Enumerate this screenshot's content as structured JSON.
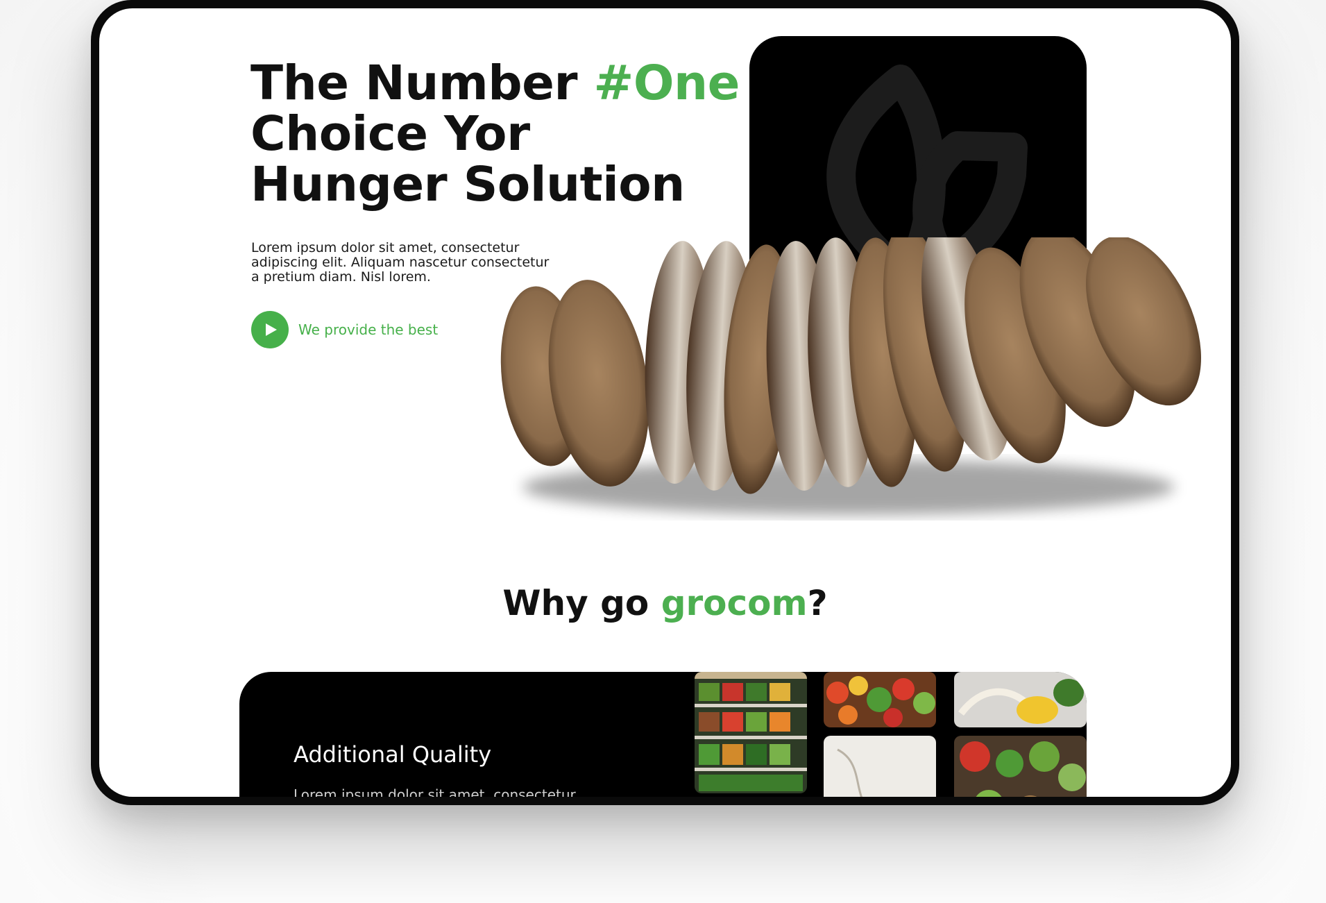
{
  "hero": {
    "headline_part1": "The Number ",
    "headline_accent": "#One",
    "headline_line2": "Choice Yor",
    "headline_line3": "Hunger Solution",
    "description": "Lorem ipsum dolor sit amet, consectetur adipiscing elit. Aliquam nascetur consectetur a pretium diam. Nisl lorem.",
    "cta_label": "We provide the best"
  },
  "why": {
    "prefix": "Why go ",
    "brand": "grocom",
    "suffix": "?"
  },
  "feature": {
    "title": "Additional Quality",
    "description": "Lorem ipsum dolor sit amet, consectetur"
  },
  "colors": {
    "accent": "#4caf50",
    "card_bg": "#000000",
    "text": "#111111",
    "logo_mark": "#1c1c1c"
  },
  "icons": {
    "brand_mark": "leaf-logo-icon",
    "cta": "play-icon"
  }
}
